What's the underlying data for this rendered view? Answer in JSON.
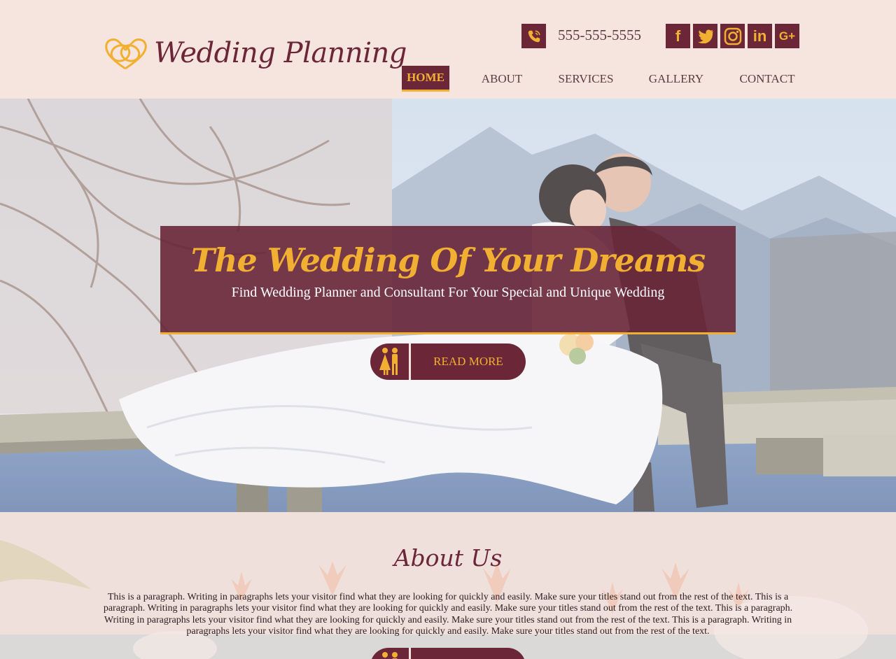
{
  "brand": {
    "name": "Wedding Planning",
    "logo_icon": "heart-rings-icon",
    "accent": "#f2b032",
    "primary": "#6b2638",
    "background": "#f6e4df"
  },
  "contact": {
    "phone": "555-555-5555",
    "phone_icon": "phone-icon"
  },
  "socials": [
    {
      "name": "facebook-icon",
      "glyph": "f"
    },
    {
      "name": "twitter-icon",
      "glyph": "t"
    },
    {
      "name": "instagram-icon",
      "glyph": "i"
    },
    {
      "name": "linkedin-icon",
      "glyph": "in"
    },
    {
      "name": "google-plus-icon",
      "glyph": "G+"
    }
  ],
  "nav": {
    "items": [
      {
        "label": "HOME",
        "active": true
      },
      {
        "label": "ABOUT",
        "active": false
      },
      {
        "label": "SERVICES",
        "active": false
      },
      {
        "label": "GALLERY",
        "active": false
      },
      {
        "label": "CONTACT",
        "active": false
      }
    ]
  },
  "hero": {
    "title": "The Wedding Of Your Dreams",
    "subtitle": "Find Wedding Planner and Consultant For Your Special and Unique Wedding",
    "button_label": "READ MORE",
    "button_icon": "couple-icon"
  },
  "about": {
    "title": "About Us",
    "body": "This is a paragraph. Writing in paragraphs lets your visitor find what they are looking for quickly and easily. Make sure your titles stand out from the rest of the text. This is a paragraph. Writing in paragraphs lets your visitor find what they are looking for quickly and easily. Make sure your titles stand out from the rest of the text. This is a paragraph. Writing in paragraphs lets your visitor find what they are looking for quickly and easily. Make sure your titles stand out from the rest of the text. This is a paragraph. Writing in paragraphs lets your visitor find what they are looking for quickly and easily. Make sure your titles stand out from the rest of the text.",
    "button_label": "",
    "button_icon": "couple-icon"
  }
}
